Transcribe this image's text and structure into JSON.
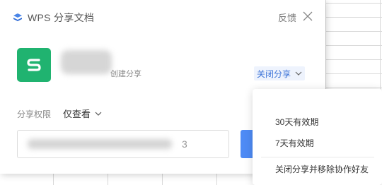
{
  "dialog": {
    "title": "WPS 分享文档",
    "feedback_label": "反馈",
    "creator_label": "创建分享",
    "close_share_label": "关闭分享",
    "permission": {
      "label": "分享权限",
      "selected": "仅查看"
    },
    "link_tail": "3"
  },
  "dropdown": {
    "items": [
      {
        "label": "30天有效期"
      },
      {
        "label": "7天有效期"
      },
      {
        "label": "关闭分享并移除协作好友"
      }
    ]
  },
  "colors": {
    "accent": "#3d74d8",
    "file_icon_bg": "#20b370",
    "copy_button": "#4e8bf5"
  },
  "icons": {
    "title": "wps-cloud-icon",
    "close": "close-icon",
    "file": "wps-spreadsheet-icon",
    "chevron": "chevron-down-icon"
  }
}
